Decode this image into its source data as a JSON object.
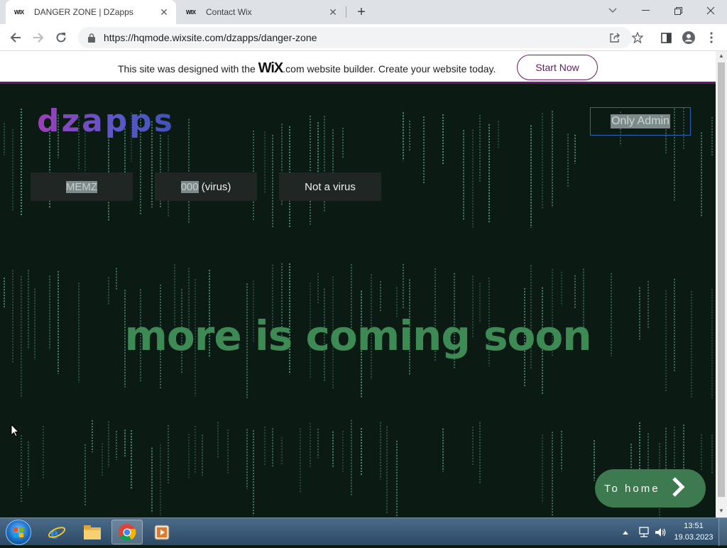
{
  "browser": {
    "tabs": [
      {
        "favicon": "WIX",
        "title": "DANGER ZONE | DZapps",
        "active": true
      },
      {
        "favicon": "WIX",
        "title": "Contact Wix",
        "active": false
      }
    ],
    "url": "https://hqmode.wixsite.com/dzapps/danger-zone"
  },
  "wix_banner": {
    "before": "This site was designed with the",
    "logo": "WiX",
    "after": ".com website builder. Create your website today.",
    "cta": "Start Now"
  },
  "page": {
    "logo": "dzapps",
    "admin_button": "Only Admin",
    "nav_buttons": [
      {
        "selected": "MEMZ",
        "rest": ""
      },
      {
        "selected": "000",
        "rest": " (virus)"
      },
      {
        "selected": "",
        "rest": "Not a virus"
      }
    ],
    "headline": "more is coming soon",
    "home_button": "To home"
  },
  "taskbar": {
    "time": "13:51",
    "date": "19.03.2023"
  },
  "colors": {
    "page_bg": "#0c1a14",
    "rain": "#5fb89a",
    "headline": "#3e8a55",
    "home_button": "#3d7a4f",
    "wix_accent": "#6a1a6b"
  }
}
